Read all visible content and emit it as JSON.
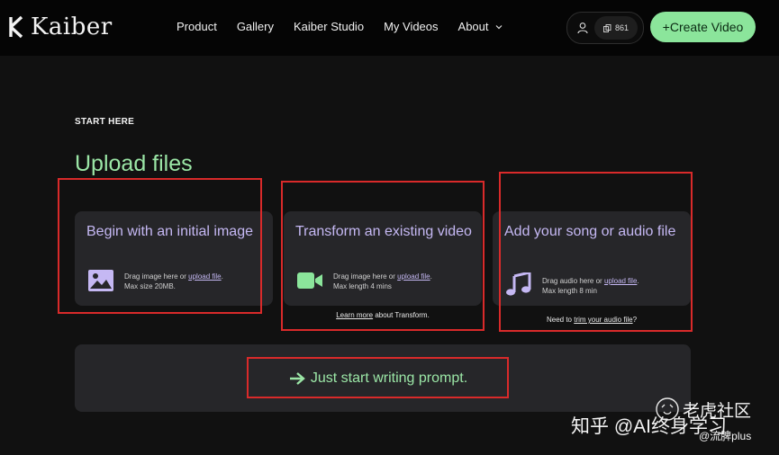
{
  "header": {
    "logo_text": "Kaiber",
    "nav": [
      "Product",
      "Gallery",
      "Kaiber Studio",
      "My Videos",
      "About"
    ],
    "credits": "861",
    "create_label": "+Create Video"
  },
  "main": {
    "eyebrow": "START HERE",
    "title": "Upload files",
    "cards": [
      {
        "title": "Begin with an initial image",
        "desc_prefix": "Drag image here or ",
        "desc_link": "upload file",
        "desc_suffix": ".",
        "desc_line2": "Max size 20MB.",
        "icon": "image-icon"
      },
      {
        "title": "Transform an existing video",
        "desc_prefix": "Drag image here or ",
        "desc_link": "upload file",
        "desc_suffix": ".",
        "desc_line2": "Max length 4 mins",
        "icon": "video-camera-icon",
        "foot_link": "Learn more",
        "foot_text": " about Transform."
      },
      {
        "title": "Add your song or audio file",
        "desc_prefix": "Drag audio here or ",
        "desc_link": "upload file",
        "desc_suffix": ".",
        "desc_line2": "Max length 8 min",
        "icon": "music-note-icon",
        "foot_prefix": "Need to ",
        "foot_link": "trim your audio file",
        "foot_suffix": "?"
      }
    ],
    "prompt_label": "Just start writing prompt."
  },
  "watermark": {
    "left": "知乎 @AI终身学习",
    "right_top": "老虎社区",
    "right_bottom": "@流脾plus"
  },
  "colors": {
    "accent_green": "#8be59b",
    "accent_purple": "#c5b8f3",
    "annotation_red": "#d92a2a"
  }
}
